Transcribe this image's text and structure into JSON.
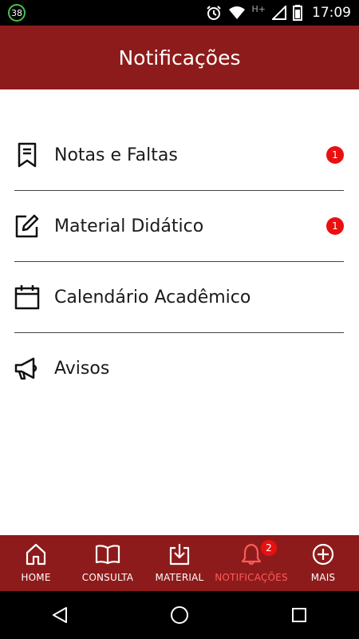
{
  "status_bar": {
    "notification_count": "38",
    "network_type": "H+",
    "time": "17:09",
    "icons": [
      "alarm-icon",
      "wifi-icon",
      "signal-icon",
      "battery-icon"
    ]
  },
  "header": {
    "title": "Notificações"
  },
  "menu": {
    "items": [
      {
        "label": "Notas e Faltas",
        "icon": "bookmark-icon",
        "badge": "1"
      },
      {
        "label": "Material Didático",
        "icon": "edit-icon",
        "badge": "1"
      },
      {
        "label": "Calendário Acadêmico",
        "icon": "calendar-icon",
        "badge": ""
      },
      {
        "label": "Avisos",
        "icon": "megaphone-icon",
        "badge": ""
      }
    ]
  },
  "bottom_nav": {
    "items": [
      {
        "label": "HOME",
        "icon": "home-icon"
      },
      {
        "label": "CONSULTA",
        "icon": "book-icon"
      },
      {
        "label": "MATERIAL",
        "icon": "download-icon"
      },
      {
        "label": "NOTIFICAÇÕES",
        "icon": "bell-icon",
        "badge": "2",
        "active": true
      },
      {
        "label": "MAIS",
        "icon": "plus-circle-icon"
      }
    ]
  },
  "colors": {
    "primary": "#8e1b1b",
    "badge": "#ea1010",
    "active_nav": "#ff5b5b",
    "text": "#1a1a1a"
  }
}
